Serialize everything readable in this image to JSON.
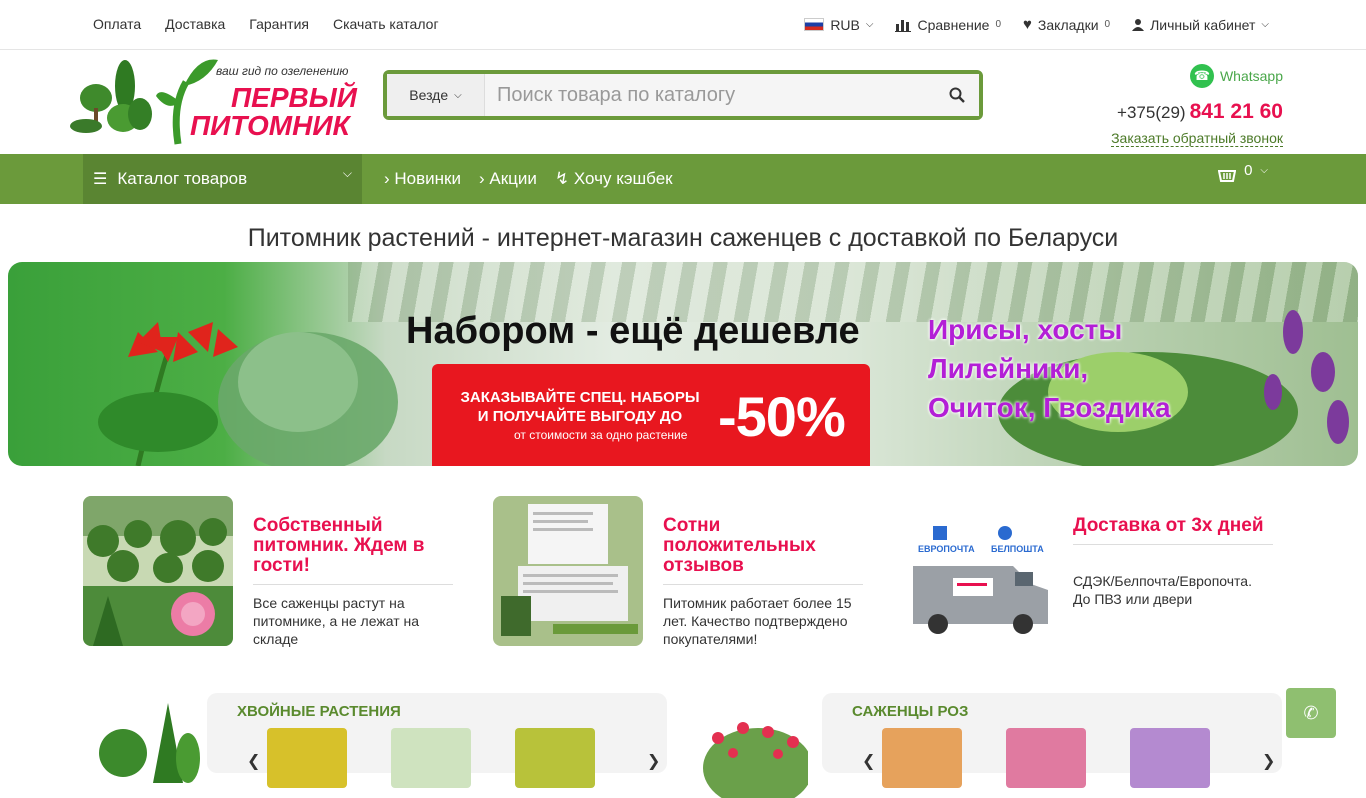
{
  "topbar": {
    "links": [
      "Оплата",
      "Доставка",
      "Гарантия",
      "Скачать каталог"
    ],
    "currency": "RUB",
    "compare_label": "Сравнение",
    "compare_count": "0",
    "bookmarks_label": "Закладки",
    "bookmarks_count": "0",
    "account_label": "Личный кабинет"
  },
  "logo": {
    "slogan": "ваш гид по озеленению",
    "name_line1": "ПЕРВЫЙ",
    "name_line2": "ПИТОМНИК"
  },
  "search": {
    "scope": "Везде",
    "placeholder": "Поиск товара по каталогу"
  },
  "contacts": {
    "whatsapp": "Whatsapp",
    "phone_prefix": "+375(29)",
    "phone_number": "841 21 60",
    "callback": "Заказать обратный звонок"
  },
  "nav": {
    "catalog": "Каталог товаров",
    "links": [
      "Новинки",
      "Акции",
      "Хочу кэшбек"
    ],
    "cart_count": "0"
  },
  "page_title": "Питомник растений - интернет-магазин саженцев с доставкой по Беларуси",
  "banner": {
    "headline": "Набором - ещё дешевле",
    "promo_line1": "ЗАКАЗЫВАЙТЕ СПЕЦ. НАБОРЫ",
    "promo_line2": "И ПОЛУЧАЙТЕ ВЫГОДУ ДО",
    "promo_line3": "от стоимости за одно растение",
    "promo_percent": "-50%",
    "plants": [
      "Ирисы, хосты",
      "Лилейники,",
      "Очиток, Гвоздика"
    ]
  },
  "features": [
    {
      "title": "Собственный питомник. Ждем в гости!",
      "desc": "Все саженцы растут на питомнике, а не лежат на складе"
    },
    {
      "title": "Сотни положительных отзывов",
      "desc": "Питомник работает более 15 лет. Качество подтверждено покупателями!"
    },
    {
      "title": "Доставка от 3х дней",
      "desc": "СДЭК/Белпочта/Европочта. До ПВЗ или двери"
    }
  ],
  "delivery_logos": {
    "evropochta": "ЕВРОПОЧТА",
    "belpochta": "БЕЛПОШТА"
  },
  "categories": [
    {
      "title": "ХВОЙНЫЕ РАСТЕНИЯ"
    },
    {
      "title": "САЖЕНЦЫ РОЗ"
    }
  ],
  "colors": {
    "brand_green": "#6b9a3b",
    "brand_pink": "#e8104f",
    "promo_red": "#e8171f",
    "plants_purple": "#b31fd6"
  }
}
